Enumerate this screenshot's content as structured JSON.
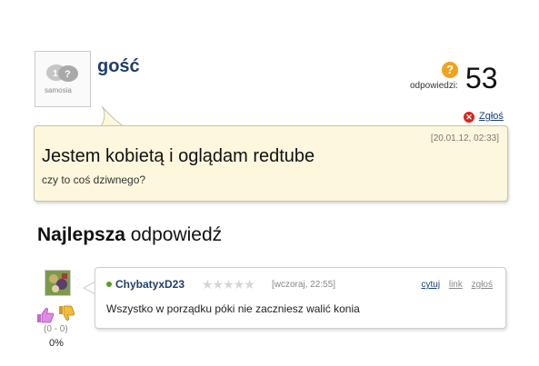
{
  "question": {
    "asker": "gość",
    "avatar_logo_text": "samosia",
    "answers_label": "odpowiedzi:",
    "answers_count": "53",
    "report_label": "Zgłoś",
    "date": "[20.01.12, 02:33]",
    "title": "Jestem kobietą i oglądam redtube",
    "body": "czy to coś dziwnego?"
  },
  "best_answer": {
    "heading_bold": "Najlepsza",
    "heading_rest": "odpowiedź",
    "user": "ChybatyxD23",
    "stars": "★★★★★",
    "rating": 0,
    "time": "[wczoraj, 22:55]",
    "actions": {
      "cite": "cytuj",
      "link": "link",
      "report": "zgłoś"
    },
    "body": "Wszystko w porządku póki nie zaczniesz walić konia",
    "votes": "(0 - 0)",
    "percent": "0%"
  },
  "colors": {
    "username": "#1f3f6c",
    "question_bg": "#fdf8dd",
    "accent_orange": "#f4a11d",
    "report_red": "#d9261c",
    "online_green": "#58a01e"
  },
  "icons": {
    "question": "question-mark-icon",
    "report": "close-circle-icon",
    "thumb_up": "thumb-up-icon",
    "thumb_down": "thumb-down-icon"
  }
}
